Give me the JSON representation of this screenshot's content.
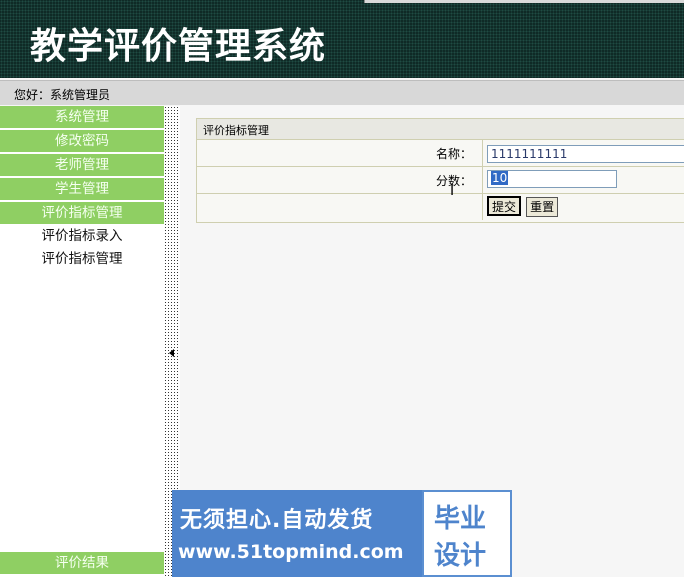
{
  "header": {
    "title": "教学评价管理系统"
  },
  "greeting": "您好：系统管理员",
  "sidebar": {
    "items": [
      {
        "label": "系统管理"
      },
      {
        "label": "修改密码"
      },
      {
        "label": "老师管理"
      },
      {
        "label": "学生管理"
      },
      {
        "label": "评价指标管理"
      }
    ],
    "subitems": [
      {
        "label": "评价指标录入"
      },
      {
        "label": "评价指标管理"
      }
    ],
    "bottom_item": {
      "label": "评价结果"
    }
  },
  "form": {
    "title": "评价指标管理",
    "name_label": "名称：",
    "name_value": "1111111111",
    "score_label": "分数：",
    "score_value": "10",
    "submit_label": "提交",
    "reset_label": "重置"
  },
  "watermark": {
    "line1": "无须担心.自动发货",
    "line2": "www.51topmind.com",
    "badge1": "毕业",
    "badge2": "设计"
  }
}
